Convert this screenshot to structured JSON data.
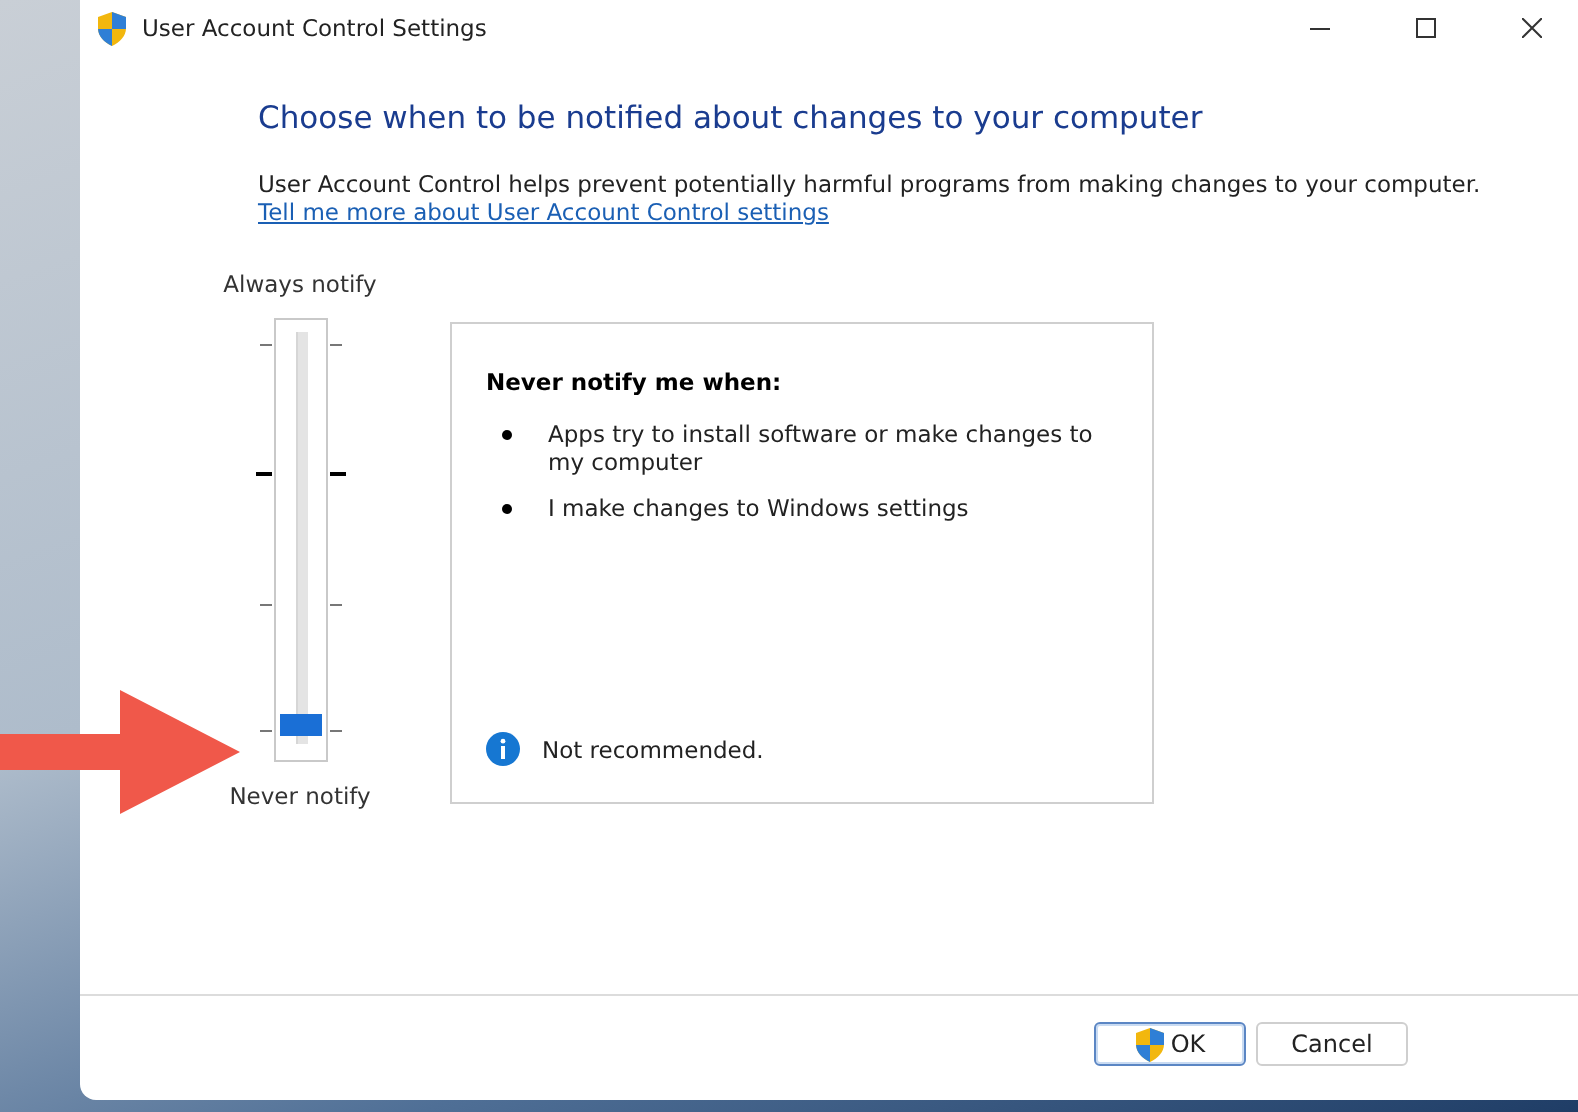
{
  "window": {
    "title": "User Account Control Settings"
  },
  "heading": "Choose when to be notified about changes to your computer",
  "description": "User Account Control helps prevent potentially harmful programs from making changes to your computer.",
  "link": "Tell me more about User Account Control settings",
  "slider": {
    "top_label": "Always notify",
    "bottom_label": "Never notify",
    "level": 0
  },
  "panel": {
    "title": "Never notify me when:",
    "bullets": [
      "Apps try to install software or make changes to my computer",
      "I make changes to Windows settings"
    ],
    "note": "Not recommended."
  },
  "buttons": [
    {
      "label": "OK",
      "kind": "shield",
      "default": true
    },
    {
      "label": "Cancel",
      "kind": "plain",
      "default": false
    }
  ]
}
